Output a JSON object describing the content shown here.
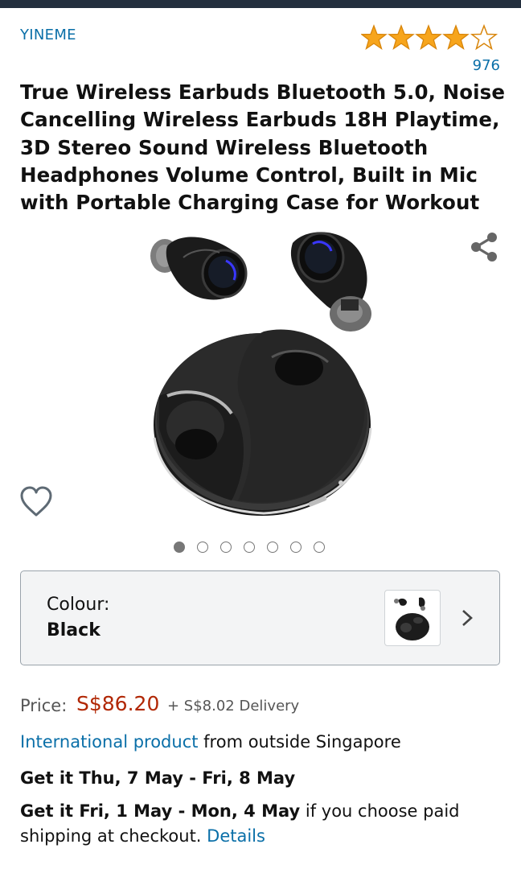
{
  "brand": "YINEME",
  "rating": {
    "stars": 4,
    "max": 5,
    "count": "976"
  },
  "title": "True Wireless Earbuds Bluetooth 5.0, Noise Cancelling Wireless Earbuds 18H Playtime, 3D Stereo Sound Wireless Bluetooth Headphones Volume Control, Built in Mic with Portable Charging Case for Workout",
  "gallery": {
    "image_count": 7,
    "active_index": 0
  },
  "colour": {
    "label": "Colour:",
    "value": "Black"
  },
  "price": {
    "label": "Price:",
    "value": "S$86.20",
    "delivery": "+ S$8.02 Delivery"
  },
  "international": {
    "link": "International product",
    "rest": " from outside Singapore"
  },
  "delivery_standard": "Get it Thu, 7 May - Fri, 8 May",
  "delivery_paid": {
    "bold": "Get it Fri, 1 May - Mon, 4 May",
    "rest": " if you choose paid shipping at checkout. ",
    "link": "Details"
  },
  "colors": {
    "link": "#0a6fa8",
    "price": "#b12704",
    "star": "#f7a51c",
    "header": "#232f3e"
  },
  "icons": [
    "star-icon",
    "share-icon",
    "heart-icon",
    "chevron-right-icon"
  ]
}
